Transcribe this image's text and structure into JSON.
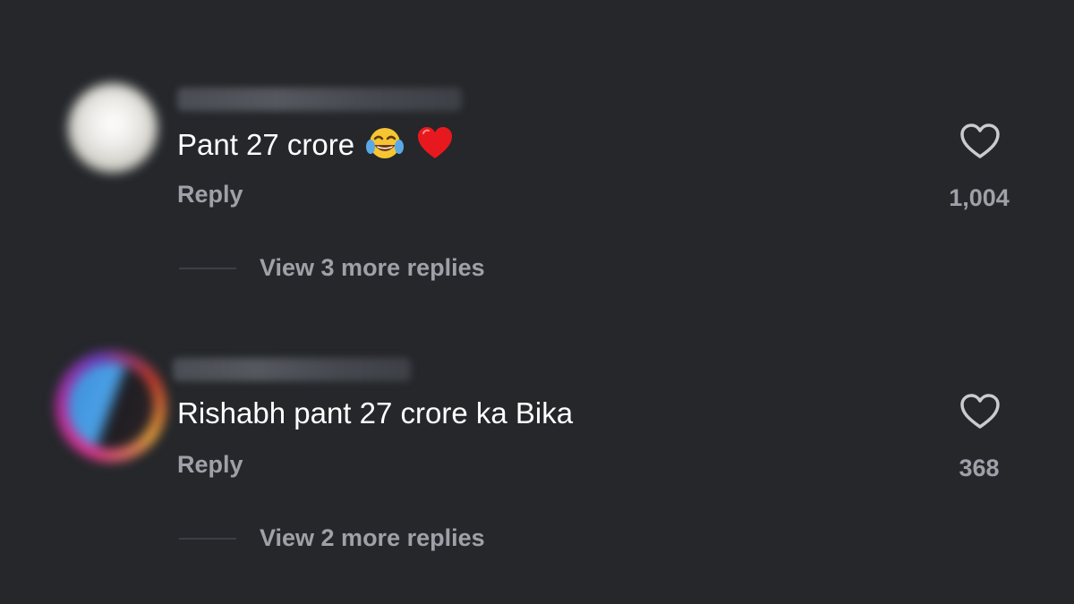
{
  "comments": [
    {
      "text": "Pant 27 crore",
      "emojis": [
        "face-with-tears-of-joy",
        "red-heart"
      ],
      "reply_label": "Reply",
      "like_count": "1,004",
      "view_replies_label": "View 3 more replies"
    },
    {
      "text": "Rishabh pant 27 crore ka Bika",
      "emojis": [],
      "reply_label": "Reply",
      "like_count": "368",
      "view_replies_label": "View 2 more replies"
    }
  ],
  "colors": {
    "background": "#25272b",
    "text_primary": "#ffffff",
    "text_secondary": "#9ea1a7",
    "heart_outline": "#c9cbcf"
  }
}
